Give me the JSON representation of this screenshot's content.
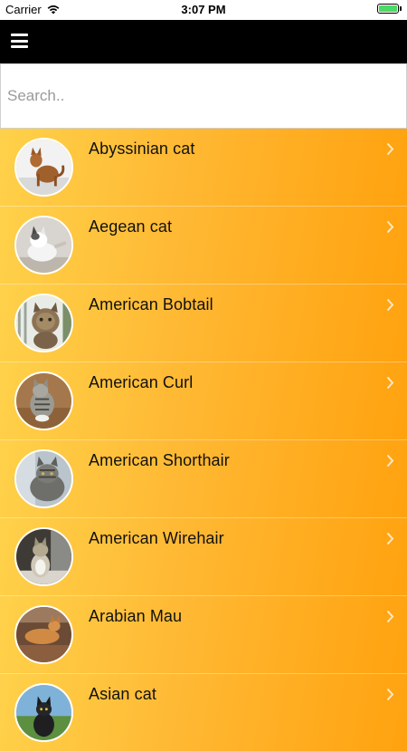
{
  "status_bar": {
    "carrier": "Carrier",
    "time": "3:07 PM",
    "battery_level": 1.0
  },
  "nav": {
    "menu_icon": "hamburger-menu-icon",
    "bar_color": "#000000"
  },
  "search": {
    "placeholder": "Search..",
    "value": ""
  },
  "list": {
    "accent_start": "#ffd14a",
    "accent_end": "#ffa20f",
    "items": [
      {
        "label": "Abyssinian cat"
      },
      {
        "label": "Aegean cat"
      },
      {
        "label": "American Bobtail"
      },
      {
        "label": "American Curl"
      },
      {
        "label": "American Shorthair"
      },
      {
        "label": "American Wirehair"
      },
      {
        "label": "Arabian Mau"
      },
      {
        "label": "Asian cat"
      }
    ]
  }
}
